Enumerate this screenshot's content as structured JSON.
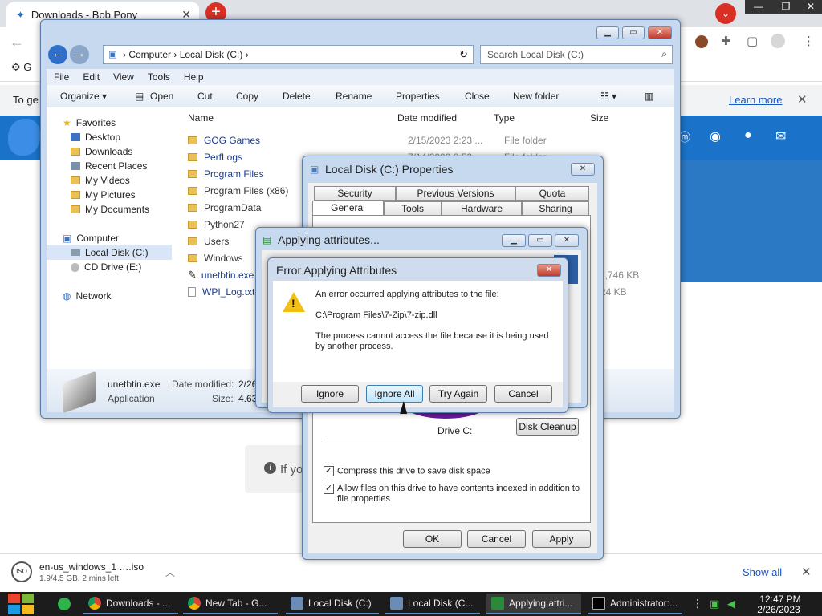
{
  "browser": {
    "tab_title": "Downloads - Bob Pony",
    "new_tab": "+",
    "bookmark_label": "G",
    "infobar_text": "To ge",
    "infobar_link": "Learn more",
    "site_snippet": "If yo",
    "shelf": {
      "file_name": "en-us_windows_1 ….iso",
      "progress_text": "1.9/4.5 GB, 2 mins left",
      "show_all": "Show all"
    }
  },
  "explorer": {
    "breadcrumb": [
      "Computer",
      "Local Disk (C:)"
    ],
    "search_placeholder": "Search Local Disk (C:)",
    "menu": [
      "File",
      "Edit",
      "View",
      "Tools",
      "Help"
    ],
    "toolbar": [
      "Organize ▾",
      "Open",
      "Cut",
      "Copy",
      "Delete",
      "Rename",
      "Properties",
      "Close",
      "New folder"
    ],
    "sidebar": {
      "favorites_header": "Favorites",
      "favorites": [
        "Desktop",
        "Downloads",
        "Recent Places",
        "My Videos",
        "My Pictures",
        "My Documents"
      ],
      "computer_header": "Computer",
      "drives": [
        "Local Disk (C:)",
        "CD Drive (E:)"
      ],
      "network": "Network"
    },
    "columns": [
      "Name",
      "Date modified",
      "Type",
      "Size"
    ],
    "files": [
      {
        "name": "GOG Games",
        "date": "2/15/2023 2:23 ...",
        "type": "File folder",
        "size": ""
      },
      {
        "name": "PerfLogs",
        "date": "7/14/2009 8:52 ...",
        "type": "File folder",
        "size": ""
      },
      {
        "name": "Program Files",
        "date": "",
        "type": "",
        "size": ""
      },
      {
        "name": "Program Files (x86)",
        "date": "",
        "type": "",
        "size": ""
      },
      {
        "name": "ProgramData",
        "date": "",
        "type": "",
        "size": ""
      },
      {
        "name": "Python27",
        "date": "",
        "type": "",
        "size": ""
      },
      {
        "name": "Users",
        "date": "",
        "type": "",
        "size": ""
      },
      {
        "name": "Windows",
        "date": "",
        "type": "",
        "size": ""
      },
      {
        "name": "unetbtin.exe",
        "date": "",
        "type": "",
        "size": "4,746 KB"
      },
      {
        "name": "WPI_Log.txt",
        "date": "",
        "type": "",
        "size": "24 KB"
      }
    ],
    "details": {
      "file": "unetbtin.exe",
      "kind": "Application",
      "date_label": "Date modified:",
      "date_value": "2/26/2",
      "size_label": "Size:",
      "size_value": "4.63 M"
    }
  },
  "properties": {
    "title": "Local Disk (C:) Properties",
    "tabs_row1": [
      "Security",
      "Previous Versions",
      "Quota"
    ],
    "tabs_row2": [
      "General",
      "Tools",
      "Hardware",
      "Sharing"
    ],
    "drive_label": "Drive C:",
    "disk_cleanup": "Disk Cleanup",
    "compress": "Compress this drive to save disk space",
    "index": "Allow files on this drive to have contents indexed in addition to file properties",
    "ok": "OK",
    "cancel": "Cancel",
    "apply": "Apply"
  },
  "applying": {
    "title": "Applying attributes..."
  },
  "error": {
    "title": "Error Applying Attributes",
    "message1": "An error occurred applying attributes to the file:",
    "path": "C:\\Program Files\\7-Zip\\7-zip.dll",
    "message2": "The process cannot access the file because it is being used by another process.",
    "ignore": "Ignore",
    "ignore_all": "Ignore All",
    "try_again": "Try Again",
    "cancel": "Cancel"
  },
  "taskbar": {
    "items": [
      "Downloads - ...",
      "New Tab - G...",
      "Local Disk (C:)",
      "Local Disk (C...",
      "Applying attri...",
      "Administrator:..."
    ],
    "time": "12:47 PM",
    "date": "2/26/2023"
  },
  "colors": {
    "accent_blue": "#1a73c8",
    "window_frame": "#c6d9ef",
    "error_close": "#c0392b"
  }
}
